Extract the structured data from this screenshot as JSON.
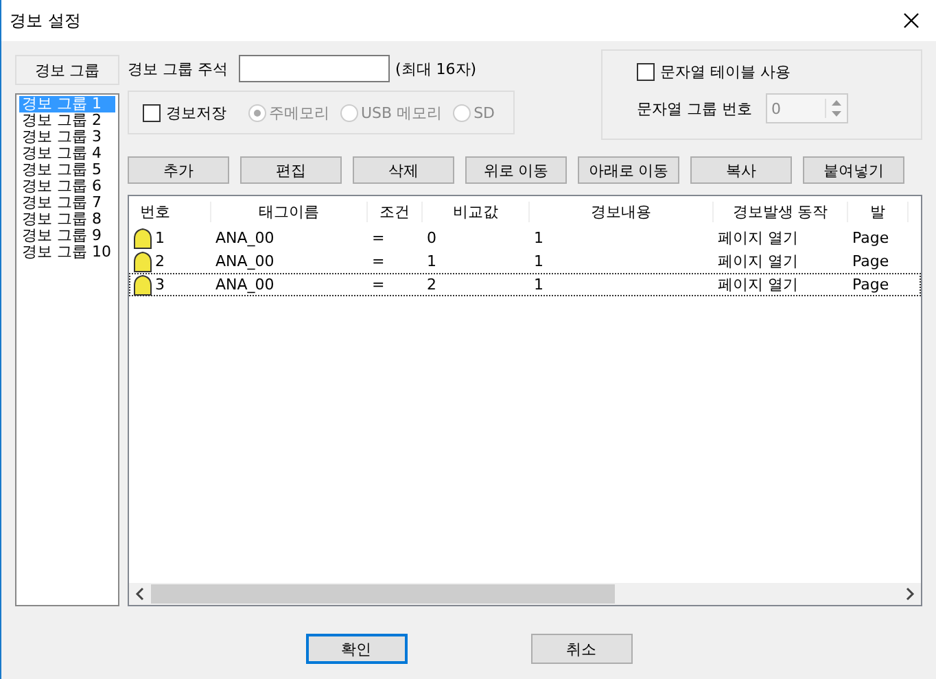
{
  "window": {
    "title": "경보 설정"
  },
  "group_panel": {
    "label": "경보 그룹",
    "items": [
      {
        "label": "경보 그룹 1",
        "selected": true
      },
      {
        "label": "경보 그룹 2",
        "selected": false
      },
      {
        "label": "경보 그룹 3",
        "selected": false
      },
      {
        "label": "경보 그룹 4",
        "selected": false
      },
      {
        "label": "경보 그룹 5",
        "selected": false
      },
      {
        "label": "경보 그룹 6",
        "selected": false
      },
      {
        "label": "경보 그룹 7",
        "selected": false
      },
      {
        "label": "경보 그룹 8",
        "selected": false
      },
      {
        "label": "경보 그룹 9",
        "selected": false
      },
      {
        "label": "경보 그룹 10",
        "selected": false
      }
    ]
  },
  "comment": {
    "label": "경보 그룹 주석",
    "hint": "(최대 16자)"
  },
  "save": {
    "label": "경보저장",
    "checked": false,
    "storage": [
      {
        "label": "주메모리",
        "selected": true,
        "disabled": true
      },
      {
        "label": "USB 메모리",
        "selected": false,
        "disabled": true
      },
      {
        "label": "SD",
        "selected": false,
        "disabled": true
      }
    ]
  },
  "string_table": {
    "label": "문자열 테이블 사용",
    "checked": false,
    "group_label": "문자열 그룹 번호",
    "group_value": "0",
    "disabled": true
  },
  "buttons": [
    "추가",
    "편집",
    "삭제",
    "위로 이동",
    "아래로 이동",
    "복사",
    "붙여넣기"
  ],
  "table": {
    "columns": [
      "번호",
      "태그이름",
      "조건",
      "비교값",
      "경보내용",
      "경보발생 동작",
      "발"
    ],
    "rows": [
      {
        "cells": [
          "1",
          "ANA_00",
          "=",
          "0",
          "1",
          "페이지 열기",
          "Page"
        ],
        "focused": false
      },
      {
        "cells": [
          "2",
          "ANA_00",
          "=",
          "1",
          "1",
          "페이지 열기",
          "Page"
        ],
        "focused": false
      },
      {
        "cells": [
          "3",
          "ANA_00",
          "=",
          "2",
          "1",
          "페이지 열기",
          "Page"
        ],
        "focused": true
      }
    ]
  },
  "footer": [
    {
      "label": "확인",
      "default": true
    },
    {
      "label": "취소",
      "default": false
    }
  ]
}
